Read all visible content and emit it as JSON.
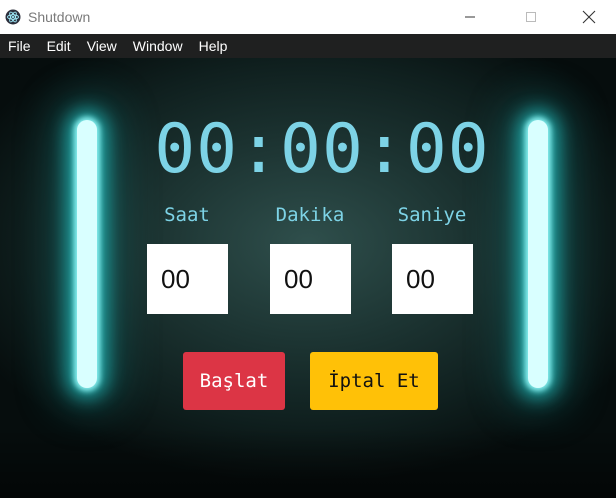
{
  "window": {
    "title": "Shutdown",
    "icon": "electron-atom-icon"
  },
  "menu": {
    "items": [
      "File",
      "Edit",
      "View",
      "Window",
      "Help"
    ]
  },
  "timer": {
    "display": "00:00:00"
  },
  "fields": {
    "hours": {
      "label": "Saat",
      "value": "00"
    },
    "minutes": {
      "label": "Dakika",
      "value": "00"
    },
    "seconds": {
      "label": "Saniye",
      "value": "00"
    }
  },
  "buttons": {
    "start": {
      "label": "Başlat",
      "color": "#dc3545"
    },
    "cancel": {
      "label": "İptal Et",
      "color": "#ffc107"
    }
  },
  "colors": {
    "accent_text": "#7dd3e6",
    "neon_glow": "#8ff4f4",
    "menubar_bg": "#1f2020"
  }
}
